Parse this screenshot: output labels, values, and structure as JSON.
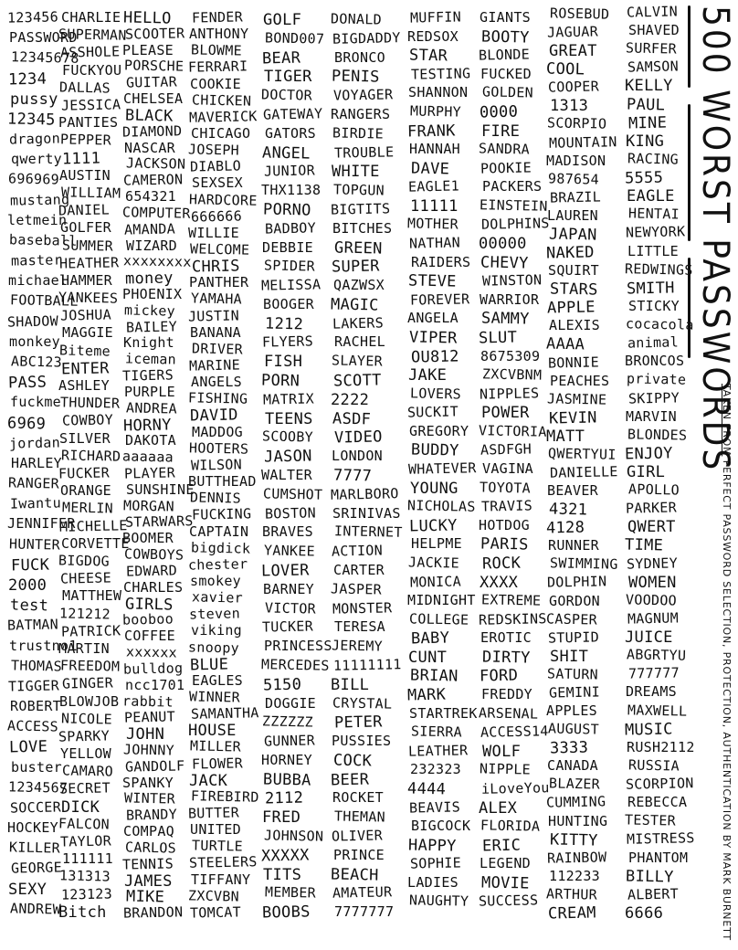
{
  "title": {
    "words": [
      "500",
      "WORST",
      "PASSWORDS"
    ],
    "subtitle_prefix": "TAKEN FROM",
    "subtitle_rest": "PERFECT PASSWORD SELECTION, PROTECTION, AUTHENTICATION BY MARK BURNETT"
  },
  "columns": [
    {
      "id": "c1",
      "words": [
        "123456",
        "PASSWORD",
        "12345678",
        "1234",
        "pussy",
        "12345",
        "dragon",
        "qwerty",
        "696969",
        "mustang",
        "letmein",
        "baseball",
        "master",
        "michael",
        "FOOTBALL",
        "SHADOW",
        "monkey",
        "ABC123",
        "PASS",
        "fuckme",
        "6969",
        "jordan",
        "HARLEY",
        "RANGER",
        "Iwantu",
        "JENNIFER",
        "HUNTER",
        "FUCK",
        "2000",
        "test",
        "BATMAN",
        "trustno1",
        "THOMAS",
        "TIGGER",
        "ROBERT",
        "ACCESS",
        "LOVE",
        "buster",
        "1234567",
        "SOCCER",
        "HOCKEY",
        "KILLER",
        "GEORGE",
        "SEXY",
        "ANDREW"
      ]
    },
    {
      "id": "c2",
      "words": [
        "CHARLIE",
        "SUPERMAN",
        "ASSHOLE",
        "FUCKYOU",
        "DALLAS",
        "JESSICA",
        "PANTIES",
        "PEPPER",
        "1111",
        "AUSTIN",
        "WILLIAM",
        "DANIEL",
        "GOLFER",
        "SUMMER",
        "HEATHER",
        "HAMMER",
        "YANKEES",
        "JOSHUA",
        "MAGGIE",
        "Biteme",
        "ENTER",
        "ASHLEY",
        "THUNDER",
        "COWBOY",
        "SILVER",
        "RICHARD",
        "FUCKER",
        "ORANGE",
        "MERLIN",
        "MICHELLE",
        "CORVETTE",
        "BIGDOG",
        "CHEESE",
        "MATTHEW",
        "121212",
        "PATRICK",
        "MARTIN",
        "FREEDOM",
        "GINGER",
        "BLOWJOB",
        "NICOLE",
        "SPARKY",
        "YELLOW",
        "CAMARO",
        "SECRET",
        "DICK",
        "FALCON",
        "TAYLOR",
        "111111",
        "131313",
        "123123",
        "Bitch"
      ]
    },
    {
      "id": "c3",
      "words": [
        "HELLO",
        "SCOOTER",
        "PLEASE",
        "PORSCHE",
        "GUITAR",
        "CHELSEA",
        "BLACK",
        "DIAMOND",
        "NASCAR",
        "JACKSON",
        "CAMERON",
        "654321",
        "COMPUTER",
        "AMANDA",
        "WIZARD",
        "xxxxxxxx",
        "money",
        "PHOENIX",
        "mickey",
        "BAILEY",
        "Knight",
        "iceman",
        "TIGERS",
        "PURPLE",
        "ANDREA",
        "HORNY",
        "DAKOTA",
        "aaaaaa",
        "PLAYER",
        "SUNSHINE",
        "MORGAN",
        "STARWARS",
        "BOOMER",
        "COWBOYS",
        "EDWARD",
        "CHARLES",
        "GIRLS",
        "booboo",
        "COFFEE",
        "xxxxxx",
        "bulldog",
        "ncc1701",
        "rabbit",
        "PEANUT",
        "JOHN",
        "JOHNNY",
        "GANDOLF",
        "SPANKY",
        "WINTER",
        "BRANDY",
        "COMPAQ",
        "CARLOS",
        "TENNIS",
        "JAMES",
        "MIKE",
        "BRANDON"
      ]
    },
    {
      "id": "c4",
      "words": [
        "FENDER",
        "ANTHONY",
        "BLOWME",
        "FERRARI",
        "COOKIE",
        "CHICKEN",
        "MAVERICK",
        "CHICAGO",
        "JOSEPH",
        "DIABLO",
        "SEXSEX",
        "HARDCORE",
        "666666",
        "WILLIE",
        "WELCOME",
        "CHRIS",
        "PANTHER",
        "YAMAHA",
        "JUSTIN",
        "BANANA",
        "DRIVER",
        "MARINE",
        "ANGELS",
        "FISHING",
        "DAVID",
        "MADDOG",
        "HOOTERS",
        "WILSON",
        "BUTTHEAD",
        "DENNIS",
        "FUCKING",
        "CAPTAIN",
        "bigdick",
        "chester",
        "smokey",
        "xavier",
        "steven",
        "viking",
        "snoopy",
        "BLUE",
        "EAGLES",
        "WINNER",
        "SAMANTHA",
        "HOUSE",
        "MILLER",
        "FLOWER",
        "JACK",
        "FIREBIRD",
        "BUTTER",
        "UNITED",
        "TURTLE",
        "STEELERS",
        "TIFFANY",
        "ZXCVBN",
        "TOMCAT"
      ]
    },
    {
      "id": "c5",
      "words": [
        "GOLF",
        "BOND007",
        "BEAR",
        "TIGER",
        "DOCTOR",
        "GATEWAY",
        "GATORS",
        "ANGEL",
        "JUNIOR",
        "THX1138",
        "PORNO",
        "BADBOY",
        "DEBBIE",
        "SPIDER",
        "MELISSA",
        "BOOGER",
        "1212",
        "FLYERS",
        "FISH",
        "PORN",
        "MATRIX",
        "TEENS",
        "SCOOBY",
        "JASON",
        "WALTER",
        "CUMSHOT",
        "BOSTON",
        "BRAVES",
        "YANKEE",
        "LOVER",
        "BARNEY",
        "VICTOR",
        "TUCKER",
        "PRINCESS",
        "MERCEDES",
        "5150",
        "DOGGIE",
        "ZZZZZZ",
        "GUNNER",
        "HORNEY",
        "BUBBA",
        "2112",
        "FRED",
        "JOHNSON",
        "XXXXX",
        "TITS",
        "MEMBER",
        "BOOBS"
      ]
    },
    {
      "id": "c6",
      "words": [
        "DONALD",
        "BIGDADDY",
        "BRONCO",
        "PENIS",
        "VOYAGER",
        "RANGERS",
        "BIRDIE",
        "TROUBLE",
        "WHITE",
        "TOPGUN",
        "BIGTITS",
        "BITCHES",
        "GREEN",
        "SUPER",
        "QAZWSX",
        "MAGIC",
        "LAKERS",
        "RACHEL",
        "SLAYER",
        "SCOTT",
        "2222",
        "ASDF",
        "VIDEO",
        "LONDON",
        "7777",
        "MARLBORO",
        "SRINIVAS",
        "INTERNET",
        "ACTION",
        "CARTER",
        "JASPER",
        "MONSTER",
        "TERESA",
        "JEREMY",
        "11111111",
        "BILL",
        "CRYSTAL",
        "PETER",
        "PUSSIES",
        "COCK",
        "BEER",
        "ROCKET",
        "THEMAN",
        "OLIVER",
        "PRINCE",
        "BEACH",
        "AMATEUR",
        "7777777"
      ]
    },
    {
      "id": "c7",
      "words": [
        "MUFFIN",
        "REDSOX",
        "STAR",
        "TESTING",
        "SHANNON",
        "MURPHY",
        "FRANK",
        "HANNAH",
        "DAVE",
        "EAGLE1",
        "11111",
        "MOTHER",
        "NATHAN",
        "RAIDERS",
        "STEVE",
        "FOREVER",
        "ANGELA",
        "VIPER",
        "OU812",
        "JAKE",
        "LOVERS",
        "SUCKIT",
        "GREGORY",
        "BUDDY",
        "WHATEVER",
        "YOUNG",
        "NICHOLAS",
        "LUCKY",
        "HELPME",
        "JACKIE",
        "MONICA",
        "MIDNIGHT",
        "COLLEGE",
        "BABY",
        "CUNT",
        "BRIAN",
        "MARK",
        "STARTREK",
        "SIERRA",
        "LEATHER",
        "232323",
        "4444",
        "BEAVIS",
        "BIGCOCK",
        "HAPPY",
        "SOPHIE",
        "LADIES",
        "NAUGHTY"
      ]
    },
    {
      "id": "c8",
      "words": [
        "GIANTS",
        "BOOTY",
        "BLONDE",
        "FUCKED",
        "GOLDEN",
        "0000",
        "FIRE",
        "SANDRA",
        "POOKIE",
        "PACKERS",
        "EINSTEIN",
        "DOLPHINS",
        "00000",
        "CHEVY",
        "WINSTON",
        "WARRIOR",
        "SAMMY",
        "SLUT",
        "8675309",
        "ZXCVBNM",
        "NIPPLES",
        "POWER",
        "VICTORIA",
        "ASDFGH",
        "VAGINA",
        "TOYOTA",
        "TRAVIS",
        "HOTDOG",
        "PARIS",
        "ROCK",
        "XXXX",
        "EXTREME",
        "REDSKINS",
        "EROTIC",
        "DIRTY",
        "FORD",
        "FREDDY",
        "ARSENAL",
        "ACCESS14",
        "WOLF",
        "NIPPLE",
        "iLoveYou",
        "ALEX",
        "FLORIDA",
        "ERIC",
        "LEGEND",
        "MOVIE",
        "SUCCESS"
      ]
    },
    {
      "id": "c9",
      "words": [
        "ROSEBUD",
        "JAGUAR",
        "GREAT",
        "COOL",
        "COOPER",
        "1313",
        "SCORPIO",
        "MOUNTAIN",
        "MADISON",
        "987654",
        "BRAZIL",
        "LAUREN",
        "JAPAN",
        "NAKED",
        "SQUIRT",
        "STARS",
        "APPLE",
        "ALEXIS",
        "AAAA",
        "BONNIE",
        "PEACHES",
        "JASMINE",
        "KEVIN",
        "MATT",
        "QWERTYUI",
        "DANIELLE",
        "BEAVER",
        "4321",
        "4128",
        "RUNNER",
        "SWIMMING",
        "DOLPHIN",
        "GORDON",
        "CASPER",
        "STUPID",
        "SHIT",
        "SATURN",
        "GEMINI",
        "APPLES",
        "AUGUST",
        "3333",
        "CANADA",
        "BLAZER",
        "CUMMING",
        "HUNTING",
        "KITTY",
        "RAINBOW",
        "112233",
        "ARTHUR",
        "CREAM"
      ]
    },
    {
      "id": "c10",
      "words": [
        "CALVIN",
        "SHAVED",
        "SURFER",
        "SAMSON",
        "KELLY",
        "PAUL",
        "MINE",
        "KING",
        "RACING",
        "5555",
        "EAGLE",
        "HENTAI",
        "NEWYORK",
        "LITTLE",
        "REDWINGS",
        "SMITH",
        "STICKY",
        "cocacola",
        "animal",
        "BRONCOS",
        "private",
        "SKIPPY",
        "MARVIN",
        "BLONDES",
        "ENJOY",
        "GIRL",
        "APOLLO",
        "PARKER",
        "QWERT",
        "TIME",
        "SYDNEY",
        "WOMEN",
        "VOODOO",
        "MAGNUM",
        "JUICE",
        "ABGRTYU",
        "777777",
        "DREAMS",
        "MAXWELL",
        "MUSIC",
        "RUSH2112",
        "RUSSIA",
        "SCORPION",
        "REBECCA",
        "TESTER",
        "MISTRESS",
        "PHANTOM",
        "BILLY",
        "ALBERT",
        "6666"
      ]
    }
  ]
}
